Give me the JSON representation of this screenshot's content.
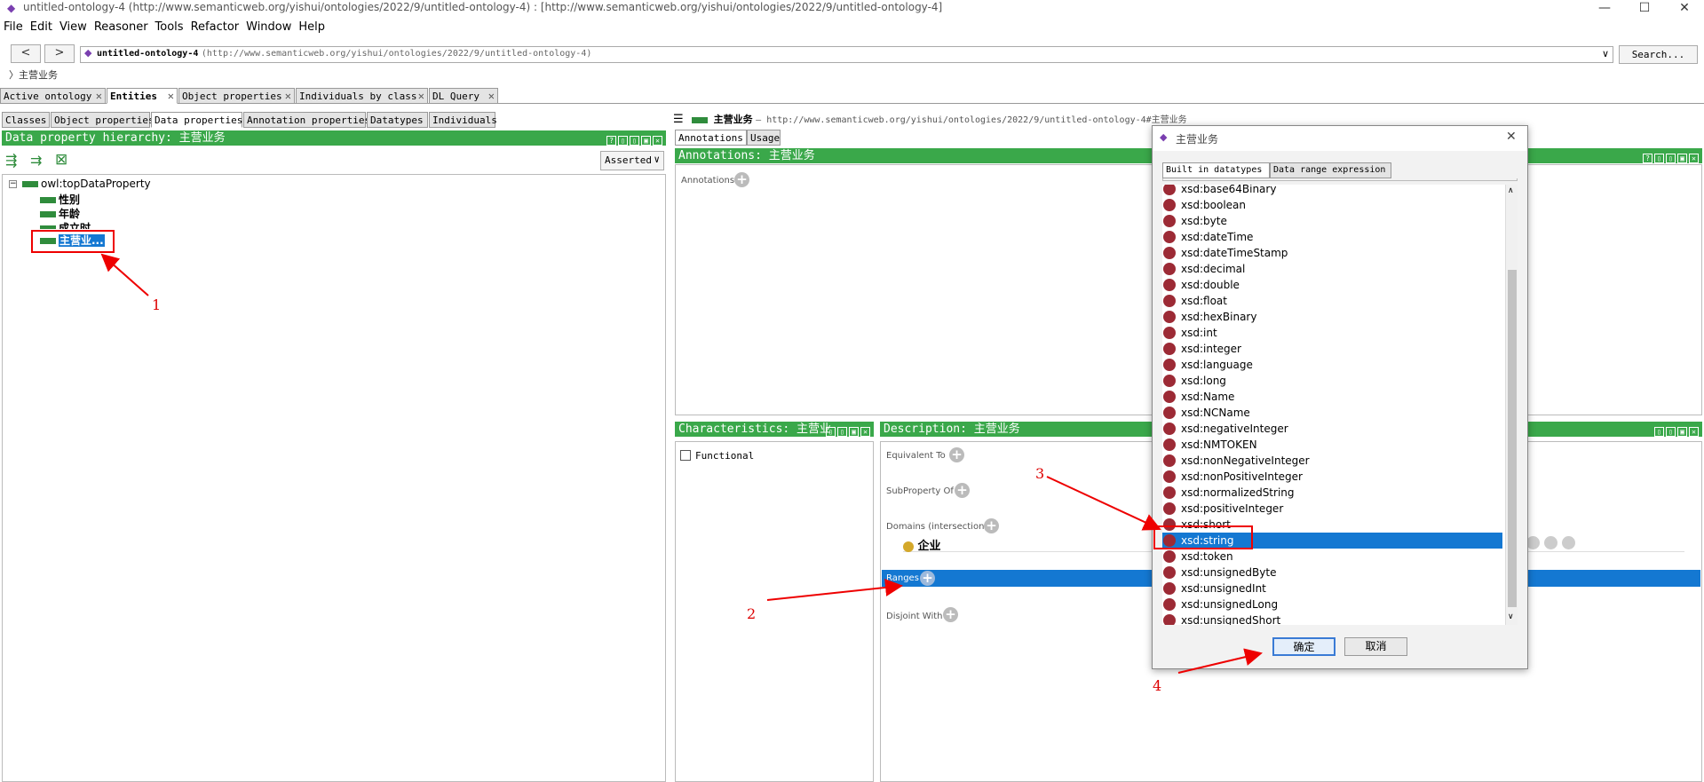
{
  "window": {
    "title": "untitled-ontology-4 (http://www.semanticweb.org/yishui/ontologies/2022/9/untitled-ontology-4)  : [http://www.semanticweb.org/yishui/ontologies/2022/9/untitled-ontology-4]",
    "minimize": "—",
    "maximize": "☐",
    "close": "✕"
  },
  "menu": [
    "File",
    "Edit",
    "View",
    "Reasoner",
    "Tools",
    "Refactor",
    "Window",
    "Help"
  ],
  "nav": {
    "back": "<",
    "forward": ">",
    "ontology_name": "untitled-ontology-4",
    "ontology_iri": "(http://www.semanticweb.org/yishui/ontologies/2022/9/untitled-ontology-4)",
    "dropdown": "∨",
    "search_label": "Search..."
  },
  "breadcrumb": "〉主营业务",
  "main_tabs": [
    {
      "label": "Active ontology",
      "close": "✕"
    },
    {
      "label": "Entities",
      "close": "✕"
    },
    {
      "label": "Object properties",
      "close": "✕"
    },
    {
      "label": "Individuals by class",
      "close": "✕"
    },
    {
      "label": "DL Query",
      "close": "✕"
    }
  ],
  "entity_tabs": [
    "Classes",
    "Object properties",
    "Data properties",
    "Annotation properties",
    "Datatypes",
    "Individuals"
  ],
  "hierarchy": {
    "title": "Data property hierarchy: 主营业务",
    "mode": "Asserted",
    "root": "owl:topDataProperty",
    "items": [
      "性别",
      "年龄",
      "成立时",
      "主营业..."
    ]
  },
  "header_entity": {
    "name": "主营业务",
    "iri": "— http://www.semanticweb.org/yishui/ontologies/2022/9/untitled-ontology-4#主营业务"
  },
  "right_tabs": [
    "Annotations",
    "Usage"
  ],
  "annotations": {
    "title": "Annotations: 主营业务",
    "label": "Annotations"
  },
  "characteristics": {
    "title": "Characteristics: 主营业\b",
    "functional": "Functional"
  },
  "description": {
    "title": "Description: 主营业务",
    "equivalent_to": "Equivalent To",
    "subproperty_of": "SubProperty Of",
    "domains": "Domains (intersection)",
    "domain_value": "企业",
    "ranges": "Ranges",
    "disjoint_with": "Disjoint With"
  },
  "dialog": {
    "title": "主营业务",
    "close": "✕",
    "tabs": [
      "Built in datatypes",
      "Data range expression"
    ],
    "items": [
      "xsd:base64Binary",
      "xsd:boolean",
      "xsd:byte",
      "xsd:dateTime",
      "xsd:dateTimeStamp",
      "xsd:decimal",
      "xsd:double",
      "xsd:float",
      "xsd:hexBinary",
      "xsd:int",
      "xsd:integer",
      "xsd:language",
      "xsd:long",
      "xsd:Name",
      "xsd:NCName",
      "xsd:negativeInteger",
      "xsd:NMTOKEN",
      "xsd:nonNegativeInteger",
      "xsd:nonPositiveInteger",
      "xsd:normalizedString",
      "xsd:positiveInteger",
      "xsd:short",
      "xsd:string",
      "xsd:token",
      "xsd:unsignedByte",
      "xsd:unsignedInt",
      "xsd:unsignedLong",
      "xsd:unsignedShort"
    ],
    "selected": "xsd:string",
    "ok": "确定",
    "cancel": "取消"
  },
  "annotations_steps": [
    "1",
    "2",
    "3",
    "4"
  ],
  "colors": {
    "green": "#3aa84a",
    "selection": "#1478d2",
    "datatype_dot": "#9c2a35",
    "annotation_red": "#e00000"
  }
}
